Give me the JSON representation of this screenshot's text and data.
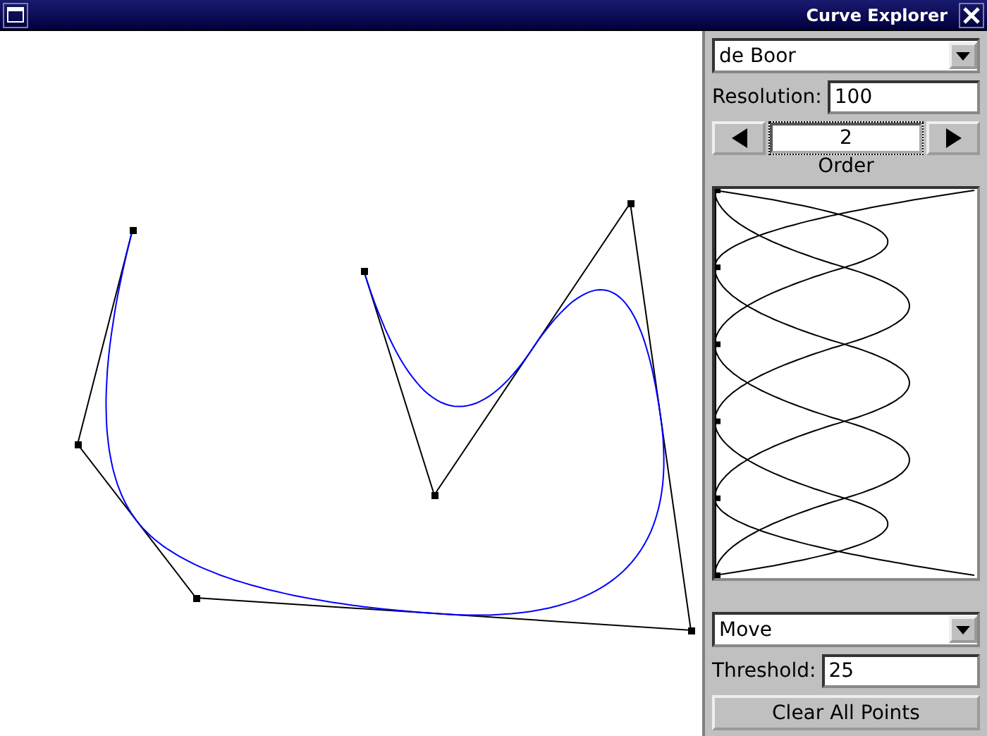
{
  "window": {
    "title": "Curve Explorer"
  },
  "curve_type": {
    "value": "de Boor"
  },
  "resolution": {
    "label": "Resolution:",
    "value": "100"
  },
  "order": {
    "value": "2",
    "label": "Order"
  },
  "mode": {
    "value": "Move"
  },
  "threshold": {
    "label": "Threshold:",
    "value": "25"
  },
  "buttons": [
    "Clear All Points"
  ]
}
